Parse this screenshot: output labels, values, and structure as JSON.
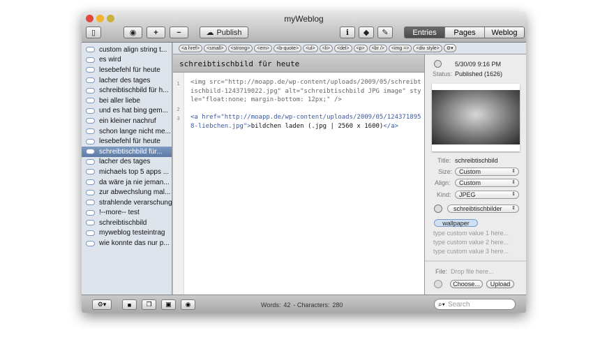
{
  "window": {
    "title": "myWeblog"
  },
  "toolbar": {
    "publish": "Publish",
    "tabs": [
      "Entries",
      "Pages",
      "Weblog"
    ],
    "active_tab": "Entries"
  },
  "sidebar": {
    "items": [
      "custom align string t...",
      "es wird",
      "lesebefehl für heute",
      "lacher des tages",
      "schreibtischbild für h...",
      "bei aller liebe",
      "und es hat bing gem...",
      "ein kleiner nachruf",
      "schon lange nicht me...",
      "lesebefehl für heute",
      "schreibtischbild für...",
      "lacher des tages",
      "michaels top 5 apps ...",
      "da wäre ja nie jeman...",
      "zur abwechslung mal...",
      "strahlende verarschung",
      "!--more-- test",
      "schreibtischbild",
      "myweblog testeintrag",
      "wie konnte das nur p..."
    ],
    "selected_index": 10
  },
  "tagbar": [
    "<a href>",
    "<small>",
    "<strong>",
    "<em>",
    "<b-quote>",
    "<ul>",
    "<li>",
    "<del>",
    "<p>",
    "<br />",
    "<img =>",
    "<div style>"
  ],
  "post": {
    "title": "schreibtischbild für heute",
    "line_numbers": [
      "1",
      "2",
      "3"
    ],
    "line1": "<img src=\"http://moapp.de/wp-content/uploads/2009/05/schreibtischbild-1243719022.jpg\" alt=\"schreibtischbild JPG image\" style=\"float:none; margin-bottom: 12px;\" />",
    "line3_open": "<a href=\"http://moapp.de/wp-content/uploads/2009/05/1243718958-liebchen.jpg\">",
    "line3_text": "bildchen laden (.jpg | 2560 x 1600)",
    "line3_close": "</a>"
  },
  "inspector": {
    "date": "5/30/09 9:16 PM",
    "status_label": "Status:",
    "status": "Published (1626)",
    "title_label": "Title:",
    "title": "schreibtischbild",
    "size_label": "Size:",
    "size": "Custom",
    "align_label": "Align:",
    "align": "Custom",
    "kind_label": "Kind:",
    "kind": "JPEG",
    "category": "schreibtischbilder",
    "tag": "wallpaper",
    "custom_placeholders": [
      "type custom value 1 here...",
      "type custom value 2 here...",
      "type custom value 3 here..."
    ],
    "file_label": "File:",
    "file_placeholder": "Drop file here...",
    "choose": "Choose...",
    "upload": "Upload"
  },
  "status_bar": {
    "words_label": "Words:",
    "words": "42",
    "chars_label": "- Characters:",
    "chars": "280"
  },
  "search": {
    "placeholder": "Search"
  }
}
